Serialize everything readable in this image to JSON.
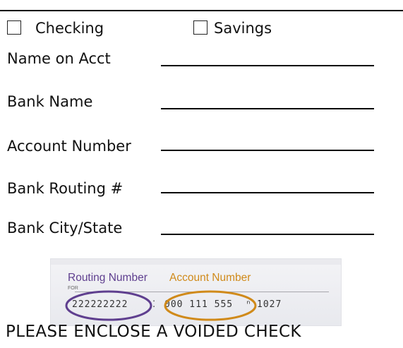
{
  "form": {
    "checkboxes": [
      {
        "label": "Checking",
        "checked": false
      },
      {
        "label": "Savings",
        "checked": false
      }
    ],
    "fields": [
      {
        "label": "Name on Acct",
        "value": ""
      },
      {
        "label": "Bank Name",
        "value": ""
      },
      {
        "label": "Account Number",
        "value": ""
      },
      {
        "label": "Bank Routing #",
        "value": ""
      },
      {
        "label": "Bank City/State",
        "value": ""
      }
    ]
  },
  "check_image": {
    "routing_label": "Routing Number",
    "account_label": "Account Number",
    "for_label": "FOR",
    "micr_routing": "222222222",
    "micr_account": "000 111 555",
    "micr_check": "1027",
    "colors": {
      "routing": "#5f3f8f",
      "account": "#d08a1a"
    }
  },
  "note": "PLEASE ENCLOSE A VOIDED CHECK"
}
